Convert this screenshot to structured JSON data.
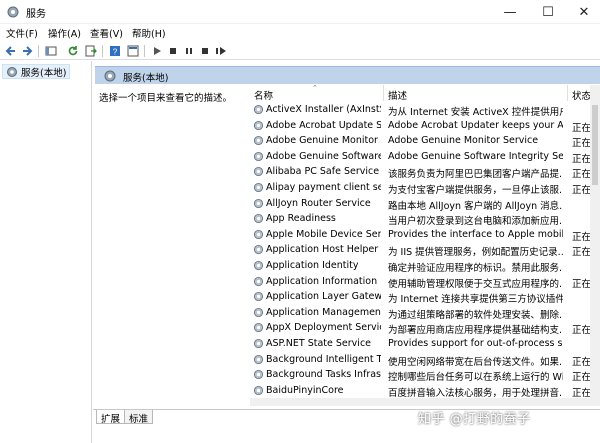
{
  "window": {
    "title": "服务"
  },
  "menu": [
    "文件(F)",
    "操作(A)",
    "查看(V)",
    "帮助(H)"
  ],
  "tree": {
    "item": "服务(本地)"
  },
  "right_header": {
    "title": "服务(本地)"
  },
  "description_pane": {
    "text": "选择一个项目来查看它的描述。"
  },
  "columns": {
    "name": "名称",
    "description": "描述",
    "status": "状态"
  },
  "services": [
    {
      "name": "ActiveX Installer (AxInstSV)",
      "description": "为从 Internet 安装 ActiveX 控件提供用户...",
      "status": ""
    },
    {
      "name": "Adobe Acrobat Update Service",
      "description": "Adobe Acrobat Updater keeps your Ad...",
      "status": "正在"
    },
    {
      "name": "Adobe Genuine Monitor Service",
      "description": "Adobe Genuine Monitor Service",
      "status": "正在"
    },
    {
      "name": "Adobe Genuine Software Integrity Service",
      "description": "Adobe Genuine Software Integrity Serv...",
      "status": "正在"
    },
    {
      "name": "Alibaba PC Safe Service",
      "description": "该服务负责为阿里巴巴集团客户端产品提...",
      "status": "正在"
    },
    {
      "name": "Alipay payment client security service",
      "description": "为支付宝客户端提供服务，一旦停止该服...",
      "status": "正在"
    },
    {
      "name": "AllJoyn Router Service",
      "description": "路由本地 AllJoyn 客户端的 AllJoyn 消息...",
      "status": ""
    },
    {
      "name": "App Readiness",
      "description": "当用户初次登录到这台电脑和添加新应用...",
      "status": ""
    },
    {
      "name": "Apple Mobile Device Service",
      "description": "Provides the interface to Apple mobile...",
      "status": "正在"
    },
    {
      "name": "Application Host Helper Service",
      "description": "为 IIS 提供管理服务，例如配置历史记录...",
      "status": "正在"
    },
    {
      "name": "Application Identity",
      "description": "确定并验证应用程序的标识。禁用此服务...",
      "status": ""
    },
    {
      "name": "Application Information",
      "description": "使用辅助管理权限便于交互式应用程序的...",
      "status": "正在"
    },
    {
      "name": "Application Layer Gateway Service",
      "description": "为 Internet 连接共享提供第三方协议插件...",
      "status": ""
    },
    {
      "name": "Application Management",
      "description": "为通过组策略部署的软件处理安装、删除...",
      "status": ""
    },
    {
      "name": "AppX Deployment Service (AppXSVC)",
      "description": "为部署应用商店应用程序提供基础结构支...",
      "status": "正在"
    },
    {
      "name": "ASP.NET State Service",
      "description": "Provides support for out-of-process se...",
      "status": ""
    },
    {
      "name": "Background Intelligent Transfer Service",
      "description": "使用空闲网络带宽在后台传送文件。如果...",
      "status": "正在"
    },
    {
      "name": "Background Tasks Infrastructure Service",
      "description": "控制哪些后台任务可以在系统上运行的 Wi...",
      "status": "正在"
    },
    {
      "name": "BaiduPinyinCore",
      "description": "百度拼音输入法核心服务，用于处理拼音...",
      "status": "正在"
    }
  ],
  "tabs": [
    "扩展",
    "标准"
  ],
  "watermark": "知乎 @打野的蚕子"
}
